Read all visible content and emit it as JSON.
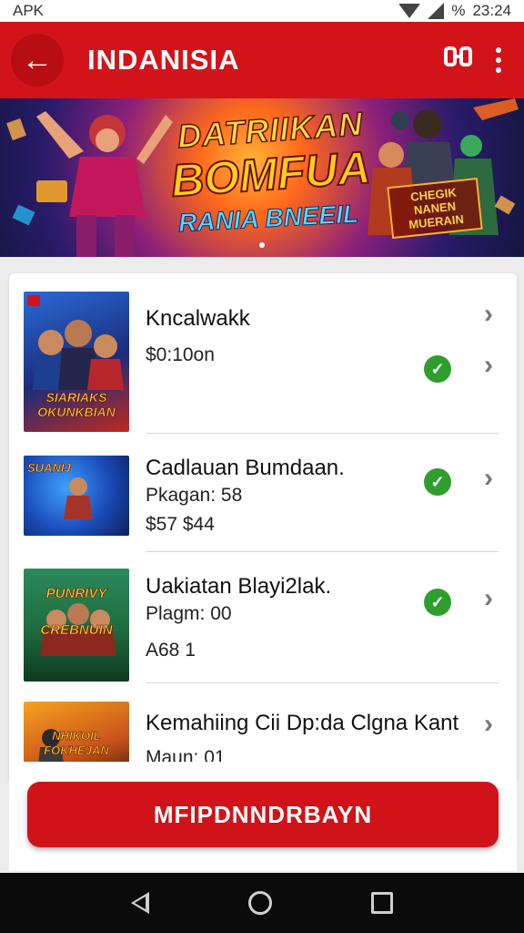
{
  "status_bar": {
    "carrier": "APK",
    "battery": "%",
    "time": "23:24"
  },
  "app_bar": {
    "title": "INDANISIA",
    "share_icon": "share-icon",
    "menu_icon": "more-vert-icon"
  },
  "banner": {
    "line1": "DATRIIKAN",
    "line2": "BOMFUA",
    "line3": "RANIA BNEEIL",
    "badge": "CHEGIK NANEN MUERAIN",
    "dot_count": 1
  },
  "list": {
    "items": [
      {
        "thumb_caption": "SIARIAKS OKUNKBIAN",
        "title": "Kncalwakk",
        "subtitle": "$0:10on",
        "price": "",
        "checked": true
      },
      {
        "thumb_caption": "SUANIJ",
        "title": "Cadlauan Bumdaan.",
        "subtitle": "Pkagan: 58",
        "price": "$57 $44",
        "checked": true
      },
      {
        "thumb_caption": "PUNRIVY CREBNUIN",
        "title": "Uakiatan Blayi2lak.",
        "subtitle": "Plagm: 00",
        "price": "A68 1",
        "checked": true
      },
      {
        "thumb_caption": "NHIKOIL FOKHEJAN",
        "title": "Kemahiing Cii Dp:da Clgna Kant",
        "subtitle": "Maun: 01",
        "price": "",
        "checked": false
      }
    ]
  },
  "cta": {
    "label": "MFIPDNNDRBAYN"
  },
  "colors": {
    "brand_red": "#d3131a",
    "check_green": "#2f9e2d"
  }
}
